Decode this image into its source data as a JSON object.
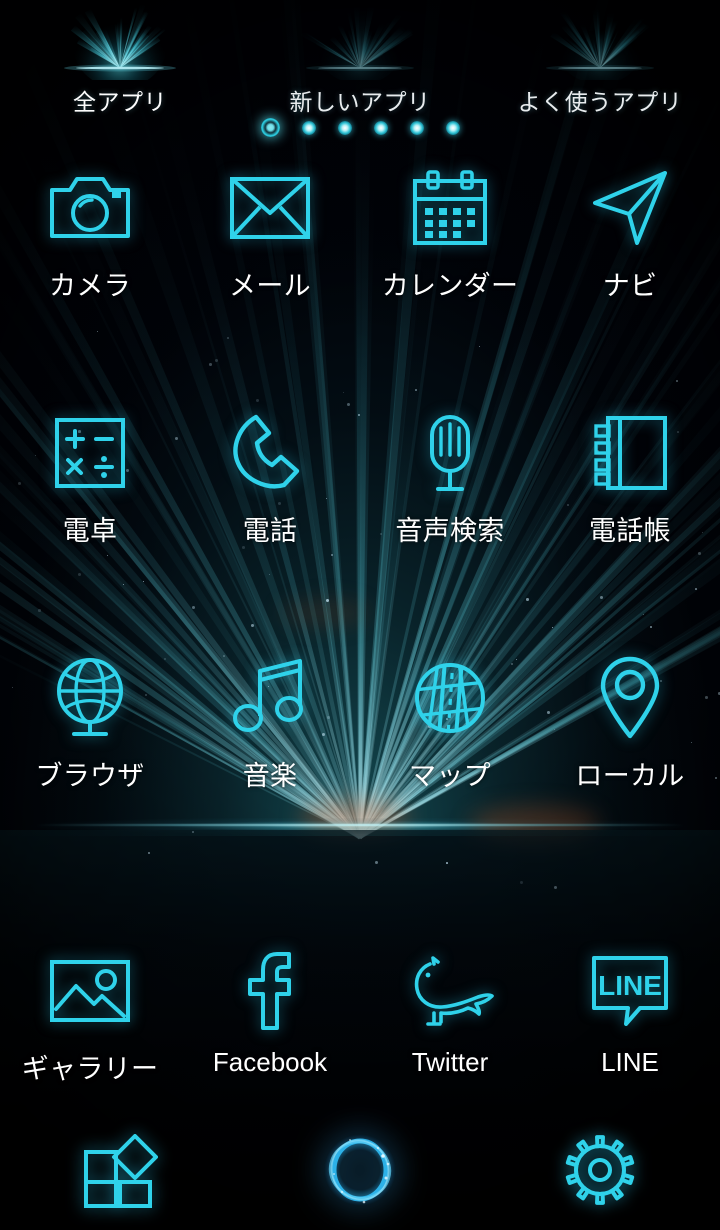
{
  "theme": {
    "accent": "#2fd2ea",
    "accent_bright": "#7ff0ff",
    "label_color": "#ffffff",
    "background": "#000107",
    "horizon_glow": "#96ebf5",
    "flare_warm": "#c45626"
  },
  "tabs": {
    "items": [
      {
        "label": "全アプリ",
        "icon": "burst-icon",
        "active": true
      },
      {
        "label": "新しいアプリ",
        "icon": "burst-icon",
        "active": false
      },
      {
        "label": "よく使うアプリ",
        "icon": "burst-icon",
        "active": false
      }
    ]
  },
  "pager": {
    "total": 6,
    "current": 1,
    "dots": [
      {
        "active": true
      },
      {
        "active": false
      },
      {
        "active": false
      },
      {
        "active": false
      },
      {
        "active": false
      },
      {
        "active": false
      }
    ]
  },
  "grid": {
    "rows": [
      {
        "apps": [
          {
            "label": "カメラ",
            "icon": "camera-icon",
            "latin": false
          },
          {
            "label": "メール",
            "icon": "mail-icon",
            "latin": false
          },
          {
            "label": "カレンダー",
            "icon": "calendar-icon",
            "latin": false
          },
          {
            "label": "ナビ",
            "icon": "navigation-icon",
            "latin": false
          }
        ]
      },
      {
        "apps": [
          {
            "label": "電卓",
            "icon": "calculator-icon",
            "latin": false
          },
          {
            "label": "電話",
            "icon": "phone-icon",
            "latin": false
          },
          {
            "label": "音声検索",
            "icon": "microphone-icon",
            "latin": false
          },
          {
            "label": "電話帳",
            "icon": "contacts-icon",
            "latin": false
          }
        ]
      },
      {
        "apps": [
          {
            "label": "ブラウザ",
            "icon": "globe-icon",
            "latin": false
          },
          {
            "label": "音楽",
            "icon": "music-icon",
            "latin": false
          },
          {
            "label": "マップ",
            "icon": "map-icon",
            "latin": false
          },
          {
            "label": "ローカル",
            "icon": "map-pin-icon",
            "latin": false
          }
        ]
      },
      {
        "apps": [
          {
            "label": "ギャラリー",
            "icon": "gallery-icon",
            "latin": false
          },
          {
            "label": "Facebook",
            "icon": "facebook-icon",
            "latin": true
          },
          {
            "label": "Twitter",
            "icon": "twitter-icon",
            "latin": true
          },
          {
            "label": "LINE",
            "icon": "line-icon",
            "latin": true
          }
        ]
      }
    ]
  },
  "dock": {
    "items": [
      {
        "name": "widgets",
        "icon": "widgets-icon"
      },
      {
        "name": "home",
        "icon": "home-ring-icon"
      },
      {
        "name": "settings",
        "icon": "gear-icon"
      }
    ]
  },
  "line_icon": {
    "text": "LINE"
  }
}
